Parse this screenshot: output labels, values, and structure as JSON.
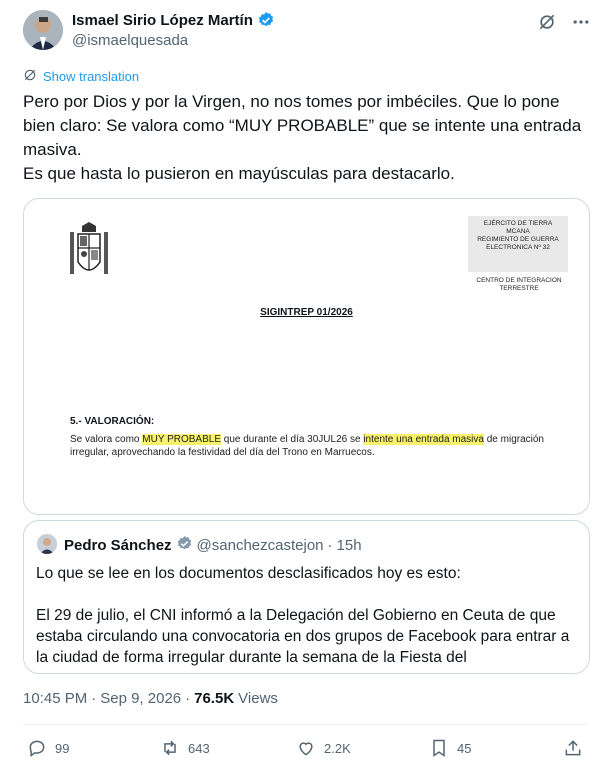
{
  "author": {
    "name": "Ismael Sirio López Martín",
    "handle": "@ismaelquesada"
  },
  "show_translation": "Show translation",
  "tweet_text": "Pero por Dios y por la Virgen, no nos tomes por imbéciles. Que lo pone bien claro: Se valora como “MUY PROBABLE” que se intente una entrada masiva.\nEs que hasta lo pusieron en mayúsculas para destacarlo.",
  "document": {
    "stamp": "EJÉRCITO DE TIERRA\nMCANA\nREGIMIENTO DE GUERRA ELECTRONICA Nº 32",
    "center": "CENTRO DE INTEGRACION TERRESTRE",
    "title": "SIGINTREP 01/2026",
    "heading": "5.- VALORACIÓN:",
    "body_1": "Se valora como ",
    "highlight_1": "MUY PROBABLE",
    "body_2": " que durante el día 30JUL26 se ",
    "highlight_2": "intente una entrada masiva",
    "body_3": " de migración irregular, aprovechando la festividad del día del Trono en Marruecos."
  },
  "quoted": {
    "name": "Pedro Sánchez",
    "handle": "@sanchezcastejon",
    "separator": "·",
    "time": "15h",
    "text": "Lo que se lee en los documentos desclasificados hoy es esto:\n\nEl 29 de julio, el CNI informó a la Delegación del Gobierno en Ceuta de que estaba circulando una convocatoria en dos grupos de Facebook para entrar a la ciudad de forma irregular durante la semana de la Fiesta del"
  },
  "meta": {
    "time": "10:45 PM",
    "separator": "·",
    "date": "Sep 9, 2026",
    "separator2": "·",
    "views_count": "76.5K",
    "views_label": "Views"
  },
  "actions": {
    "replies": "99",
    "reposts": "643",
    "likes": "2.2K",
    "bookmarks": "45"
  },
  "colors": {
    "accent": "#1d9bf0",
    "muted": "#536471",
    "highlight": "#f7f26a"
  },
  "icons": [
    "verified-icon",
    "grok-icon",
    "more-icon",
    "translate-icon",
    "reply-icon",
    "repost-icon",
    "like-icon",
    "bookmark-icon",
    "share-icon"
  ]
}
